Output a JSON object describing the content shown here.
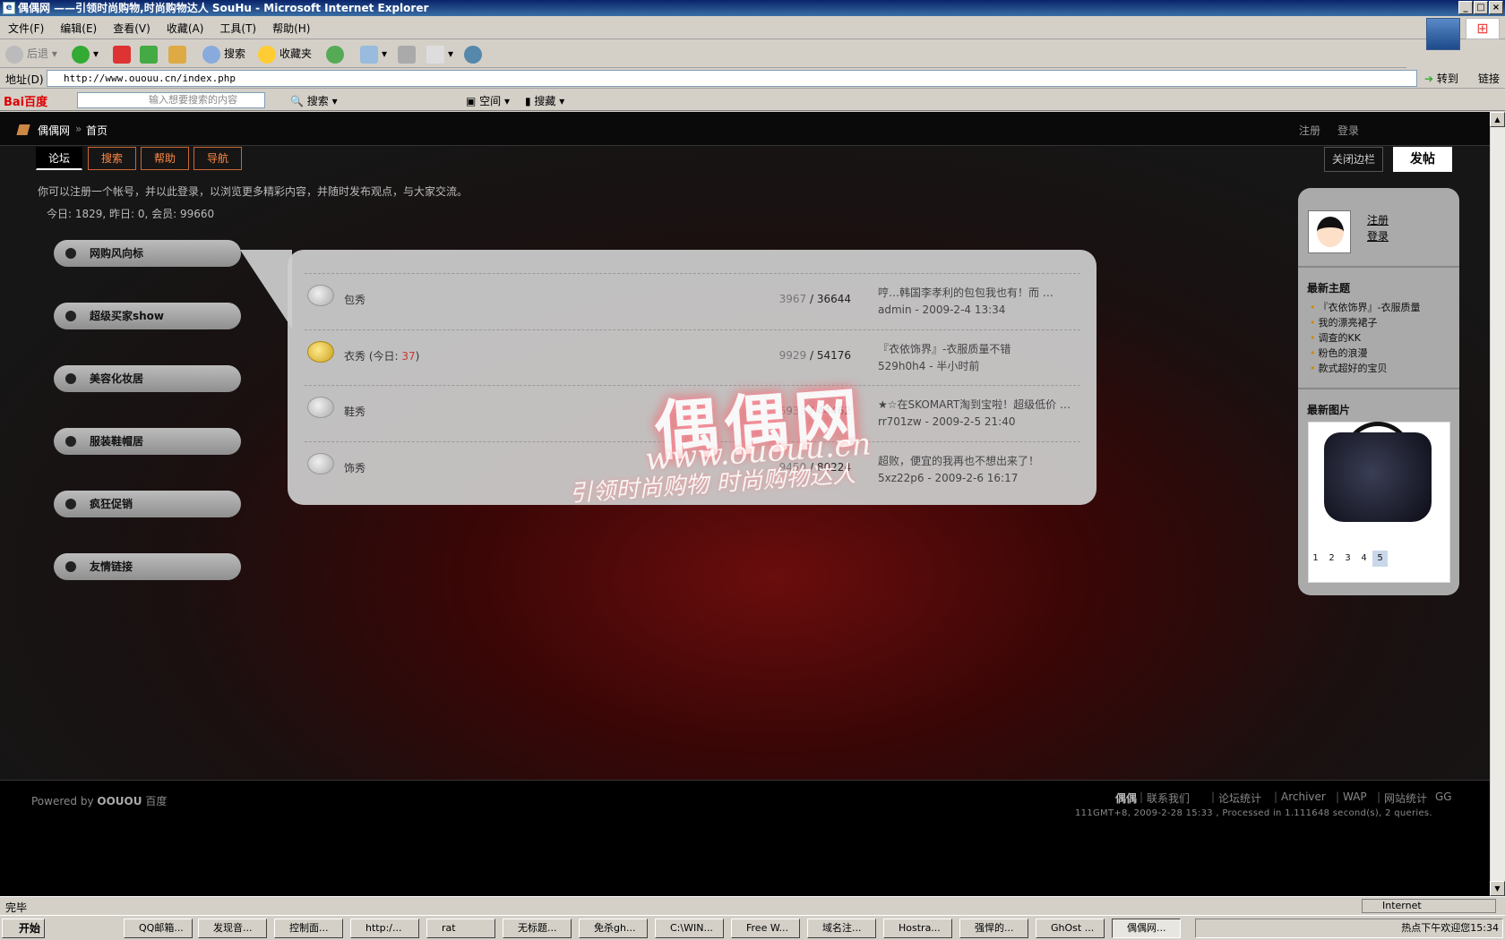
{
  "window": {
    "title": "偶偶网 ——引领时尚购物,时尚购物达人 SouHu - Microsoft Internet Explorer"
  },
  "menu": [
    "文件(F)",
    "编辑(E)",
    "查看(V)",
    "收藏(A)",
    "工具(T)",
    "帮助(H)"
  ],
  "toolbar": {
    "back": "后退",
    "search": "搜索",
    "favorites": "收藏夹"
  },
  "address": {
    "label": "地址(D)",
    "url": "http://www.ououu.cn/index.php",
    "go": "转到",
    "links": "链接"
  },
  "baidu": {
    "logo": "Bai百度",
    "placeholder": "输入想要搜索的内容",
    "search": "搜索",
    "space": "空间",
    "collect": "搜藏"
  },
  "site": {
    "breadcrumb": {
      "site": "偶偶网",
      "sep": "»",
      "page": "首页"
    },
    "top_links": {
      "register": "注册",
      "login": "登录"
    },
    "tabs": [
      "论坛",
      "搜索",
      "帮助",
      "导航"
    ],
    "close_sidebar": "关闭边栏",
    "post": "发帖",
    "intro": "你可以注册一个帐号，并以此登录，以浏览更多精彩内容，并随时发布观点，与大家交流。",
    "stats": "今日: 1829, 昨日: 0, 会员: 99660",
    "nav": [
      "网购风向标",
      "超级买家show",
      "美容化妆居",
      "服装鞋帽居",
      "疯狂促销",
      "友情链接"
    ],
    "forums": [
      {
        "name": "包秀",
        "today": "",
        "threads": "3967",
        "posts": "36644",
        "last_title": "哼…韩国李孝利的包包我也有！而 …",
        "last_by": "admin - 2009-2-4 13:34"
      },
      {
        "name": "衣秀",
        "today": "37",
        "threads": "9929",
        "posts": "54176",
        "last_title": "『衣依饰界』-衣服质量不错",
        "last_by": "529h0h4 - 半小时前"
      },
      {
        "name": "鞋秀",
        "today": "",
        "threads": "6933",
        "posts": "44462",
        "last_title": "★☆在SKOMART淘到宝啦！超级低价 …",
        "last_by": "rr701zw - 2009-2-5 21:40"
      },
      {
        "name": "饰秀",
        "today": "",
        "threads": "9450",
        "posts": "80224",
        "last_title": "超败，便宜的我再也不想出来了！",
        "last_by": "5xz22p6 - 2009-2-6 16:17"
      }
    ],
    "today_label": "今日:",
    "watermark": {
      "logo": "偶偶网",
      "url": "www.ououu.cn",
      "slogan": "引领时尚购物 时尚购物达人"
    },
    "sidebar": {
      "register": "注册",
      "login": "登录",
      "latest_title": "最新主题",
      "latest": [
        "『衣依饰界』-衣服质量",
        "我的漂亮裙子",
        "调查的KK",
        "粉色的浪漫",
        "款式超好的宝贝"
      ],
      "pic_title": "最新图片",
      "pages": [
        "1",
        "2",
        "3",
        "4",
        "5"
      ]
    },
    "footer": {
      "powered_prefix": "Powered by",
      "powered_brand": "OOUOU",
      "powered_suffix": "百度",
      "links": [
        "偶偶",
        "联系我们",
        "论坛统计",
        "Archiver",
        "WAP",
        "网站统计",
        "GG"
      ],
      "info": "111GMT+8, 2009-2-28 15:33 , Processed in 1.111648 second(s), 2 queries."
    }
  },
  "status": {
    "text": "完毕",
    "zone": "Internet"
  },
  "taskbar": {
    "start": "开始",
    "tasks": [
      "QQ邮箱...",
      "发现音...",
      "控制面...",
      "http:/...",
      "rat",
      "无标题...",
      "免杀gh...",
      "C:\\WIN...",
      "Free W...",
      "域名注...",
      "Hostra...",
      "强悍的...",
      "GhOst ...",
      "偶偶网..."
    ],
    "tray": "热点下午欢迎您15:34"
  },
  "colors": {
    "accent": "#ff8844",
    "bubble": "#cdcdcd",
    "sidebar": "#aaaaaa"
  }
}
